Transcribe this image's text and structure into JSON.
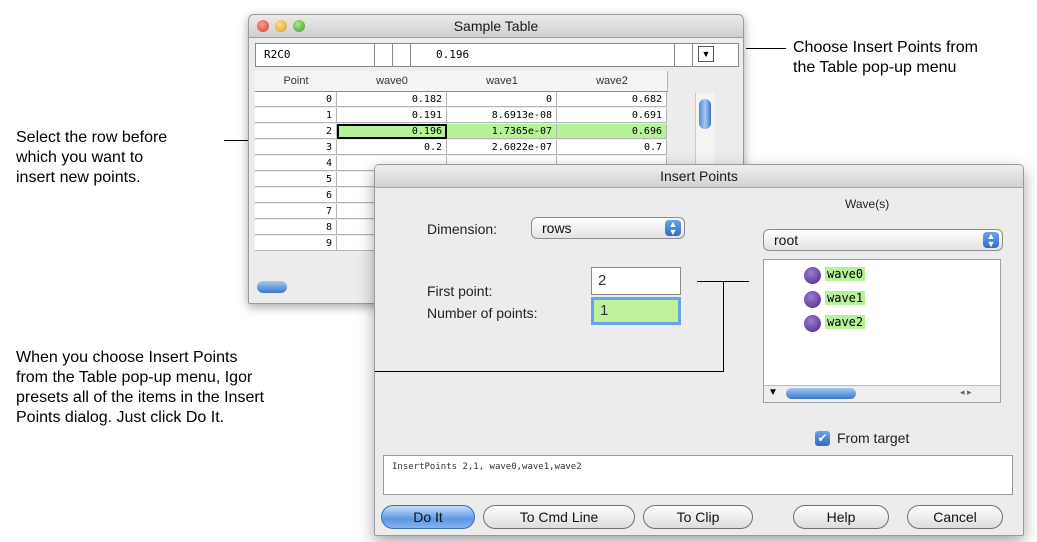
{
  "annotations": {
    "insert_menu": [
      "Choose Insert Points from",
      "the Table pop-up menu"
    ],
    "select_row": [
      "Select the row before",
      "which you want to",
      "insert new points."
    ],
    "preset": [
      "When you choose Insert Points",
      "from the Table pop-up menu, Igor",
      "presets all of the items in the Insert",
      "Points dialog. Just click Do It."
    ]
  },
  "table_window": {
    "title": "Sample Table",
    "entry_label": "R2C0",
    "entry_value": "0.196",
    "columns": [
      "Point",
      "wave0",
      "wave1",
      "wave2"
    ],
    "rows": [
      [
        "0",
        "0.182",
        "0",
        "0.682"
      ],
      [
        "1",
        "0.191",
        "8.6913e-08",
        "0.691"
      ],
      [
        "2",
        "0.196",
        "1.7365e-07",
        "0.696"
      ],
      [
        "3",
        "0.2",
        "2.6022e-07",
        "0.7"
      ],
      [
        "4",
        "",
        "",
        ""
      ],
      [
        "5",
        "",
        "",
        ""
      ],
      [
        "6",
        "",
        "",
        ""
      ],
      [
        "7",
        "",
        "",
        ""
      ],
      [
        "8",
        "",
        "",
        ""
      ],
      [
        "9",
        "",
        "",
        ""
      ]
    ],
    "selected_row_index": 2
  },
  "dialog": {
    "title": "Insert Points",
    "dimension_label": "Dimension:",
    "dimension_value": "rows",
    "waves_label": "Wave(s)",
    "folder_value": "root",
    "first_point_label": "First point:",
    "first_point_value": "2",
    "num_points_label": "Number of points:",
    "num_points_value": "1",
    "waves": [
      "wave0",
      "wave1",
      "wave2"
    ],
    "from_target_label": "From target",
    "from_target_checked": true,
    "command": "InsertPoints 2,1, wave0,wave1,wave2",
    "buttons": {
      "do_it": "Do It",
      "to_cmd_line": "To Cmd Line",
      "to_clip": "To Clip",
      "help": "Help",
      "cancel": "Cancel"
    }
  },
  "colors": {
    "selection_green": "#b6f29a",
    "accent_blue": "#3b78cc"
  }
}
